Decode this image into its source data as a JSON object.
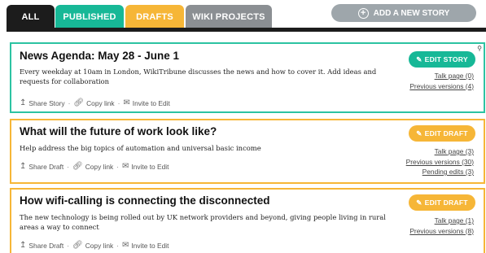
{
  "tabs": {
    "all": "ALL",
    "published": "PUBLISHED",
    "drafts": "DRAFTS",
    "wiki": "WIKI PROJECTS"
  },
  "add_story": {
    "label": "ADD A NEW STORY",
    "icon": "plus-circle-icon"
  },
  "colors": {
    "green": "#17b897",
    "orange": "#f6b637",
    "dark": "#1c1c1c",
    "grey": "#8b8f93"
  },
  "cards": [
    {
      "title": "News Agenda: May 28 - June 1",
      "description": "Every weekday at 10am in London, WikiTribune discusses the news and how to cover it. Add ideas and requests for collaboration",
      "button": "EDIT STORY",
      "actions": {
        "share": "Share Story",
        "copy": "Copy link",
        "invite": "Invite to Edit"
      },
      "links": [
        "Talk page (0)",
        "Previous versions (4)"
      ]
    },
    {
      "title": "What will the future of work look like?",
      "description": "Help address the big topics of automation and universal basic income",
      "button": "EDIT DRAFT",
      "actions": {
        "share": "Share Draft",
        "copy": "Copy link",
        "invite": "Invite to Edit"
      },
      "links": [
        "Talk page (3)",
        "Previous versions (30)",
        "Pending edits (3)"
      ]
    },
    {
      "title": "How wifi-calling is connecting the disconnected",
      "description": "The new technology is being rolled out by UK network providers and beyond, giving people living in rural areas a way to connect",
      "button": "EDIT DRAFT",
      "actions": {
        "share": "Share Draft",
        "copy": "Copy link",
        "invite": "Invite to Edit"
      },
      "links": [
        "Talk page (1)",
        "Previous versions (8)"
      ]
    }
  ]
}
